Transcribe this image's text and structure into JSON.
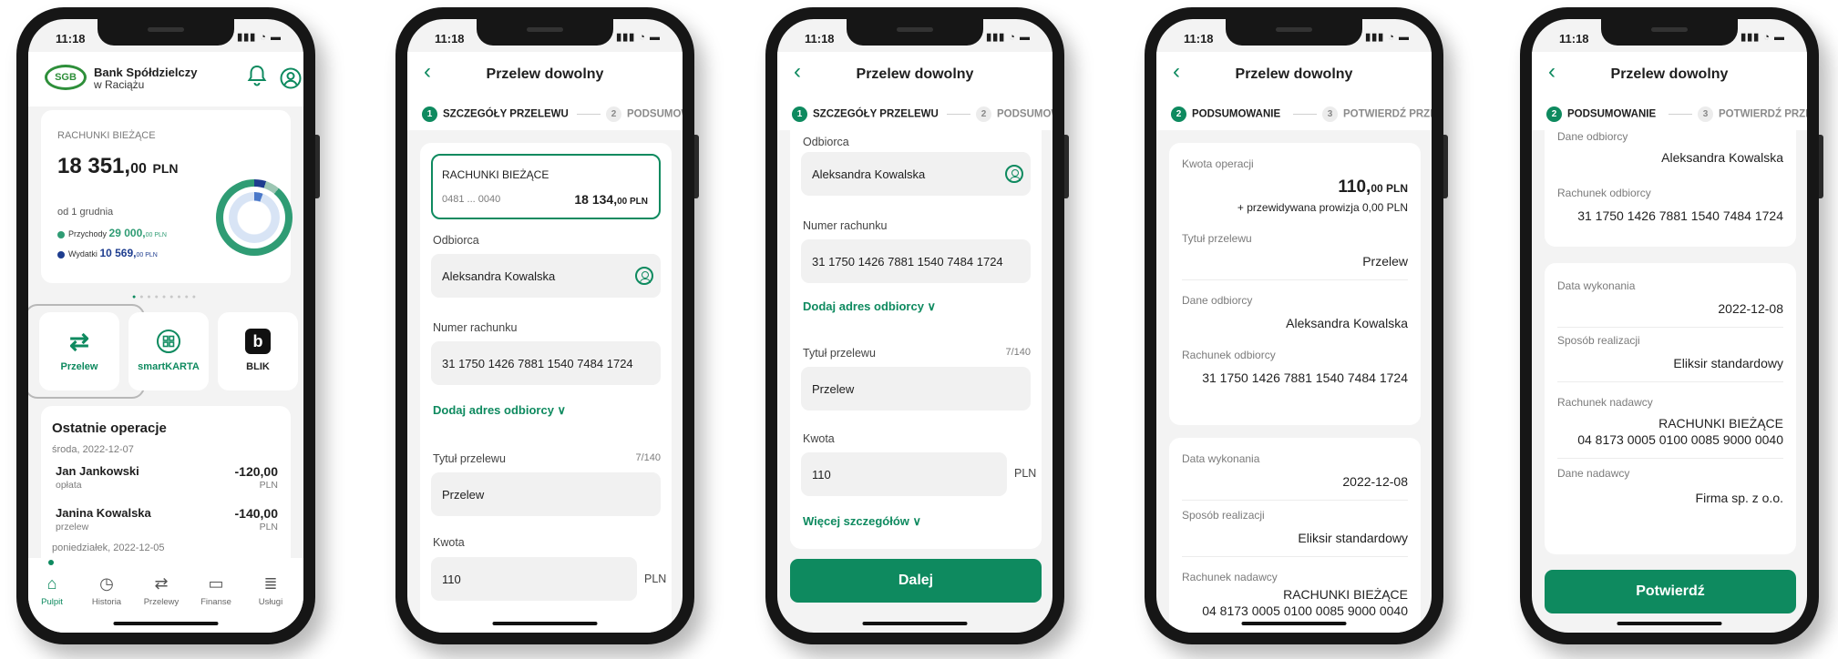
{
  "status_time": "11:18",
  "status_icons": "▮▮▮ ◔ ▬",
  "phone1": {
    "bank_name": "Bank Spółdzielczy",
    "bank_city": "w Raciążu",
    "logo_text": "SGB",
    "accounts_label": "RACHUNKI BIEŻĄCE",
    "balance_main": "18 351,",
    "balance_cents": "00",
    "balance_currency": "PLN",
    "period": "od 1 grudnia",
    "income_label": "Przychody",
    "income_value": "29 000,",
    "income_cents": "00 PLN",
    "expense_label": "Wydatki",
    "expense_value": "10 569,",
    "expense_cents": "00 PLN",
    "tiles": [
      "Przelew",
      "smartKARTA",
      "BLIK"
    ],
    "recent_title": "Ostatnie operacje",
    "date1": "środa, 2022-12-07",
    "ops": [
      {
        "name": "Jan Jankowski",
        "sub": "opłata",
        "amount": "-120,00",
        "cur": "PLN"
      },
      {
        "name": "Janina Kowalska",
        "sub": "przelew",
        "amount": "-140,00",
        "cur": "PLN"
      }
    ],
    "date2": "poniedziałek, 2022-12-05",
    "tabs": [
      "Pulpit",
      "Historia",
      "Przelewy",
      "Finanse",
      "Usługi"
    ]
  },
  "transfer": {
    "title": "Przelew dowolny",
    "step1_num": "1",
    "step1": "SZCZEGÓŁY PRZELEWU",
    "step2_num": "2",
    "step2": "PODSUMOWANIE",
    "step3_num": "3",
    "step3": "POTWIERDŹ PRZELEW",
    "account_label": "RACHUNKI BIEŻĄCE",
    "account_number_short": "0481 ... 0040",
    "account_balance": "18 134,",
    "account_balance_cents": "00 PLN",
    "recipient_label": "Odbiorca",
    "recipient_value": "Aleksandra Kowalska",
    "account_num_label": "Numer rachunku",
    "account_num_value": "31 1750 1426 7881 1540 7484 1724",
    "add_address": "Dodaj adres odbiorcy ∨",
    "title_label": "Tytuł przelewu",
    "title_counter": "7/140",
    "title_value": "Przelew",
    "amount_label": "Kwota",
    "amount_value": "110",
    "amount_currency": "PLN",
    "more_details": "Więcej szczegółów ∨",
    "next_button": "Dalej"
  },
  "summary": {
    "amount_label": "Kwota operacji",
    "amount_main": "110,",
    "amount_cents": "00 PLN",
    "fee_note": "+ przewidywana prowizja 0,00 PLN",
    "title_label": "Tytuł przelewu",
    "title_value": "Przelew",
    "recipient_data_label": "Dane odbiorcy",
    "recipient_data_value": "Aleksandra Kowalska",
    "recipient_account_label": "Rachunek odbiorcy",
    "recipient_account_value": "31 1750 1426 7881 1540 7484 1724",
    "exec_date_label": "Data wykonania",
    "exec_date_value": "2022-12-08",
    "method_label": "Sposób realizacji",
    "method_value": "Eliksir standardowy",
    "sender_account_label": "Rachunek nadawcy",
    "sender_account_name": "RACHUNKI BIEŻĄCE",
    "sender_account_number": "04 8173 0005 0100 0085 9000 0040",
    "sender_data_label": "Dane nadawcy",
    "sender_data_value": "Firma sp. z o.o.",
    "confirm_button": "Potwierdź"
  }
}
